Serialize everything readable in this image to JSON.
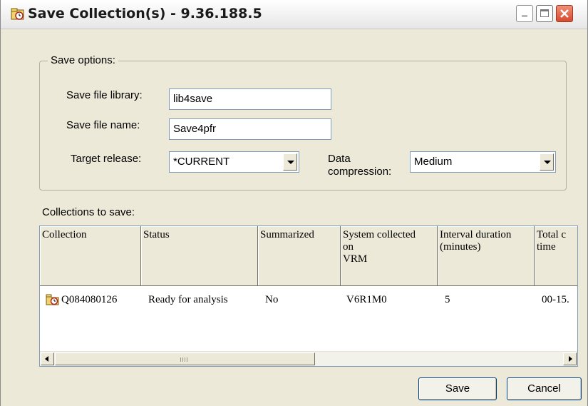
{
  "window": {
    "title": "Save Collection(s) - 9.36.188.5"
  },
  "save_options": {
    "legend": "Save options:",
    "library_label": "Save file library:",
    "library_value": "lib4save",
    "name_label": "Save file name:",
    "name_value": "Save4pfr",
    "target_label": "Target release:",
    "target_value": "*CURRENT",
    "compression_label_1": "Data",
    "compression_label_2": "compression:",
    "compression_value": "Medium"
  },
  "collections": {
    "label": "Collections to save:",
    "columns": [
      "Collection",
      "Status",
      "Summarized",
      "System collected on VRM",
      "Interval duration (minutes)",
      "Total collection time"
    ],
    "header_lines": [
      [
        "Collection"
      ],
      [
        "Status"
      ],
      [
        "Summarized"
      ],
      [
        "System collected",
        "on",
        "VRM"
      ],
      [
        "Interval duration",
        "(minutes)"
      ],
      [
        "Total c",
        "time"
      ]
    ],
    "rows": [
      {
        "collection": "Q084080126",
        "status": "Ready for analysis",
        "summarized": "No",
        "vrm": "V6R1M0",
        "interval": "5",
        "total_time": "00-15."
      }
    ],
    "scroll_grip": "III"
  },
  "buttons": {
    "save": "Save",
    "cancel": "Cancel"
  },
  "icons": {
    "title": "collection-icon",
    "row": "folder-collection-icon",
    "minimize": "minimize-icon",
    "maximize": "maximize-icon",
    "close": "close-icon"
  },
  "colors": {
    "window_bg": "#ece9d8",
    "border_blue": "#7f9db9",
    "close_red": "#d64a2c"
  }
}
